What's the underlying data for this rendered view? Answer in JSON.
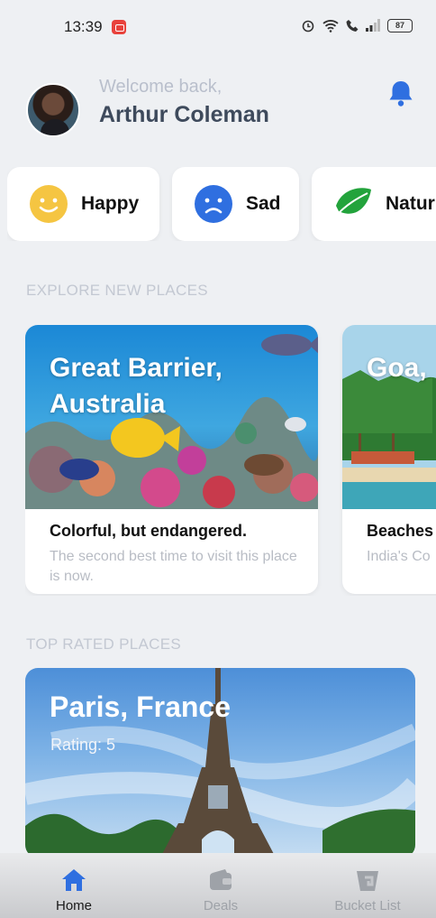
{
  "status_bar": {
    "time": "13:39",
    "battery": "87"
  },
  "header": {
    "welcome": "Welcome back,",
    "user_name": "Arthur Coleman"
  },
  "moods": [
    {
      "label": "Happy",
      "icon": "smile-icon",
      "color": "#f5c542"
    },
    {
      "label": "Sad",
      "icon": "sad-face-icon",
      "color": "#2f6fe0"
    },
    {
      "label": "Natur",
      "icon": "leaf-icon",
      "color": "#23a33c"
    }
  ],
  "explore": {
    "title": "EXPLORE NEW PLACES",
    "cards": [
      {
        "name": "Great Barrier, Australia",
        "title": "Colorful, but endangered.",
        "description": "The second best time to visit this place is now."
      },
      {
        "name": "Goa,",
        "title": "Beaches",
        "description": "India's Co"
      }
    ]
  },
  "top_rated": {
    "title": "TOP RATED PLACES",
    "cards": [
      {
        "name": "Paris, France",
        "rating": "Rating: 5"
      }
    ]
  },
  "nav": [
    {
      "label": "Home",
      "icon": "home-icon",
      "active": true
    },
    {
      "label": "Deals",
      "icon": "wallet-icon",
      "active": false
    },
    {
      "label": "Bucket List",
      "icon": "bucket-icon",
      "active": false
    }
  ],
  "colors": {
    "accent": "#2f6fe0",
    "background": "#eef0f3",
    "muted": "#c3c8d2",
    "inactive_nav": "#9ea2a8"
  }
}
